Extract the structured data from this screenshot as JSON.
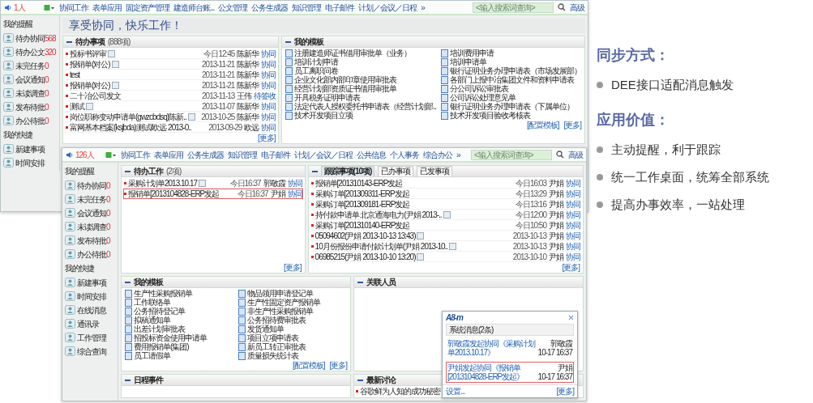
{
  "back_window": {
    "user_count": "1人",
    "nav": [
      "协同工作",
      "表单应用",
      "固定资产管理",
      "建造师台账...",
      "公文管理",
      "公务生成器",
      "知识管理",
      "电子邮件",
      "计划／会议／日程",
      "»"
    ],
    "search": {
      "placeholder": "<输入搜索词查询>"
    },
    "advanced": "高级",
    "sidebar": {
      "title": "我的提醒",
      "items": [
        {
          "label": "待办协同",
          "count": "568"
        },
        {
          "label": "待办公文",
          "count": "320"
        },
        {
          "label": "未完任务",
          "count": "0"
        },
        {
          "label": "会议通知",
          "count": "0"
        },
        {
          "label": "未读调查",
          "count": "0"
        },
        {
          "label": "发布待批",
          "count": "0"
        },
        {
          "label": "办公待批",
          "count": "0"
        }
      ],
      "shortcuts_title": "我的快捷",
      "shortcuts": [
        "新建事项",
        "时间安排"
      ]
    },
    "banner": "享受协同，快乐工作！",
    "todo": {
      "title": "待办事项",
      "count": "(888项)",
      "more": "[更多]",
      "rows": [
        {
          "title": "投标书评审",
          "attachment": true,
          "date": "今日12:45",
          "person": "陈新华",
          "type": "协同",
          "selected": false
        },
        {
          "title": "报销单(对公)",
          "attachment": true,
          "date": "2013-11-21",
          "person": "陈新华",
          "type": "协同",
          "selected": false
        },
        {
          "title": "test",
          "attachment": false,
          "date": "2013-11-21",
          "person": "陈新华",
          "type": "协同",
          "selected": false
        },
        {
          "title": "报销单(对公)",
          "attachment": true,
          "date": "2013-11-21",
          "person": "陈新华",
          "type": "协同",
          "selected": false
        },
        {
          "title": "二十冶公司发文",
          "attachment": false,
          "date": "2013-11-13",
          "person": "王伟",
          "type": "待签收",
          "selected": false
        },
        {
          "title": "测试",
          "attachment": true,
          "date": "2013-11-07",
          "person": "陈新华",
          "type": "协同",
          "selected": false
        },
        {
          "title": "岗位职称变动申请单(gwzcbdsq)陈新..",
          "attachment": true,
          "date": "2013-10-25",
          "person": "陈新华",
          "type": "协同",
          "selected": false
        },
        {
          "title": "富网基本档案(ksjbda)测试/欧远 2013-0..",
          "attachment": false,
          "date": "2013-09-29",
          "person": "欧远",
          "type": "协同",
          "selected": false
        }
      ]
    },
    "templates": {
      "title": "我的模板",
      "links": [
        "[配置模板]",
        "[更多]"
      ],
      "items": [
        "注册建造师证书借用审批单（业务）",
        "培训费用申请",
        "培训计划申请",
        "培训申请单",
        "员工离职问卷",
        "银行证明业务办理申请表（市场发展部）",
        "企业文化部内部印章使用审批表",
        "各部门上报中冶集团文件和资料申请表",
        "经营计划部资质证书借用审批单",
        "分公司诉讼审批表",
        "开具税务证明申请表",
        "公司诉讼处理意见单",
        "法定代表人授权委托书申请表（经营计划部..",
        "银行证明业务办理申请表（下属单位）",
        "技术开发项目立项",
        "技术开发项目验收考核表"
      ]
    }
  },
  "front_window": {
    "user_count": "126人",
    "nav": [
      "协同工作",
      "表单应用",
      "公务生成器",
      "知识管理",
      "电子邮件",
      "计划／会议／日程",
      "公共信息",
      "个人事务",
      "综合办公",
      "»"
    ],
    "search": {
      "placeholder": "<输入搜索词查询>"
    },
    "advanced": "高级",
    "sidebar": {
      "title": "我的提醒",
      "items": [
        {
          "label": "待办协同",
          "count": "0"
        },
        {
          "label": "未完任务",
          "count": "0"
        },
        {
          "label": "会议通知",
          "count": "0"
        },
        {
          "label": "未读调查",
          "count": "0"
        },
        {
          "label": "发布待批",
          "count": "0"
        },
        {
          "label": "办公待批",
          "count": "0"
        }
      ],
      "shortcuts_title": "我的快捷",
      "shortcuts": [
        "新建事项",
        "时间安排",
        "在线消息",
        "通讯录",
        "工作管理",
        "综合查询"
      ]
    },
    "todo": {
      "title": "待办工作",
      "count": "(2项)",
      "more": "[更多]",
      "rows": [
        {
          "title": "采购计划单2013.10.17",
          "attachment": true,
          "date": "今日16:37",
          "person": "郭敬霞",
          "type": "协同",
          "selected": false
        },
        {
          "title": "报销单[2013104828-ERP发起",
          "attachment": false,
          "date": "今日16:37",
          "person": "尹娟",
          "type": "协同",
          "selected": true
        }
      ]
    },
    "tracking": {
      "tabs": [
        {
          "label": "跟踪事项(10项)",
          "selected": true
        },
        {
          "label": "已办事项",
          "selected": false
        },
        {
          "label": "已发事项",
          "selected": false
        }
      ],
      "more": "[更多]",
      "rows": [
        {
          "title": "报销单[201310143-ERP发起",
          "attachment": false,
          "date": "今日16:03",
          "person": "尹娟",
          "type": "协同",
          "selected": false
        },
        {
          "title": "采购订单[201309311-ERP发起",
          "attachment": false,
          "date": "今日13:29",
          "person": "尹娟",
          "type": "协同",
          "selected": false
        },
        {
          "title": "采购订单[201309181-ERP发起",
          "attachment": false,
          "date": "今日13:16",
          "person": "尹娟",
          "type": "协同",
          "selected": false
        },
        {
          "title": "持付款申请单 北京通海电力(尹娟 2013-..",
          "attachment": true,
          "date": "今日12:00",
          "person": "尹娟",
          "type": "协同",
          "selected": false
        },
        {
          "title": "采购订单[201310140-ERP发起",
          "attachment": false,
          "date": "今日10:50",
          "person": "尹娟",
          "type": "协同",
          "selected": false
        },
        {
          "title": "05094602(尹娟 2013-10-13 13:43)",
          "attachment": true,
          "date": "2013-10-13",
          "person": "尹娟",
          "type": "协同",
          "selected": false
        },
        {
          "title": "10月份报份申请付款计划单(尹娟 2013-10..",
          "attachment": true,
          "date": "2013-10-13",
          "person": "尹娟",
          "type": "协同",
          "selected": false
        },
        {
          "title": "06985215(尹娟 2013-10-10 13:20)",
          "attachment": true,
          "date": "2013-10-10",
          "person": "尹娟",
          "type": "协同",
          "selected": false
        }
      ]
    },
    "templates": {
      "title": "我的模板",
      "links": [
        "[配置模板]",
        "[更多]"
      ],
      "items": [
        "生产性采购报销单",
        "物品领用申请登记单",
        "工作联络单",
        "生产性固定资产报销单",
        "公务招待登记单",
        "非生产性采购报销单",
        "拟稿通知单",
        "公务招待费审批表",
        "出差计划审批表",
        "发货通知单",
        "招投标资金使用申请单",
        "项目立项申请表",
        "费用报销单(集团)",
        "新员工转正审批表",
        "员工请假单",
        "质量损失统计表"
      ]
    },
    "related": {
      "title": "关联人员"
    },
    "schedule": {
      "title": "日程事件"
    },
    "discussion": {
      "title": "最新讨论",
      "rows": [
        "谷歌鲜为人知的成功秘密"
      ]
    },
    "popup": {
      "logo": "A8-m",
      "title": "系统消息(2条)",
      "messages": [
        {
          "text": "郭敬霞发起协同《采购计划单2013.10.17》",
          "person": "郭敬霞",
          "time": "10-17 16:37",
          "selected": false
        },
        {
          "text": "尹娟发起协同《报销单[2013104828-ERP发起》",
          "person": "尹娟",
          "time": "10-17 16:37",
          "selected": true
        }
      ],
      "settings": "设置...",
      "more": "[更多]"
    }
  },
  "info": {
    "sections": [
      {
        "heading": "同步方式：",
        "bullets": [
          "DEE接口适配消息触发"
        ]
      },
      {
        "heading": "应用价值：",
        "bullets": [
          "主动提醒，利于跟踪",
          "统一工作桌面，统筹全部系统",
          "提高办事效率，一站处理"
        ]
      }
    ]
  }
}
